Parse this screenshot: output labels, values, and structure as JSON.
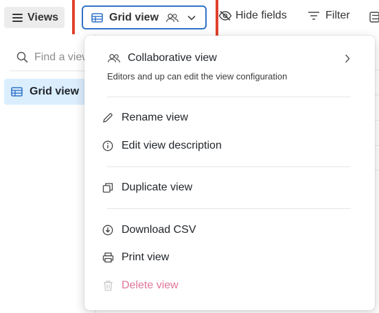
{
  "toolbar": {
    "views_label": "Views",
    "grid_view_label": "Grid view",
    "hide_fields_label": "Hide fields",
    "filter_label": "Filter"
  },
  "sidebar": {
    "search_placeholder": "Find a view",
    "items": [
      {
        "label": "Grid view",
        "icon": "grid-icon",
        "selected": true
      }
    ]
  },
  "menu": {
    "header_title": "Collaborative view",
    "header_desc": "Editors and up can edit the view configuration",
    "items": [
      {
        "label": "Rename view",
        "icon": "pencil-icon"
      },
      {
        "label": "Edit view description",
        "icon": "info-icon"
      },
      {
        "label": "Duplicate view",
        "icon": "duplicate-icon"
      },
      {
        "label": "Download CSV",
        "icon": "download-icon"
      },
      {
        "label": "Print view",
        "icon": "printer-icon"
      },
      {
        "label": "Delete view",
        "icon": "trash-icon",
        "color": "#e07499"
      }
    ]
  },
  "colors": {
    "accent": "#2f72c7",
    "highlight_box": "#e0412a",
    "selected_bg": "#dbeefe",
    "danger": "#e07499"
  }
}
